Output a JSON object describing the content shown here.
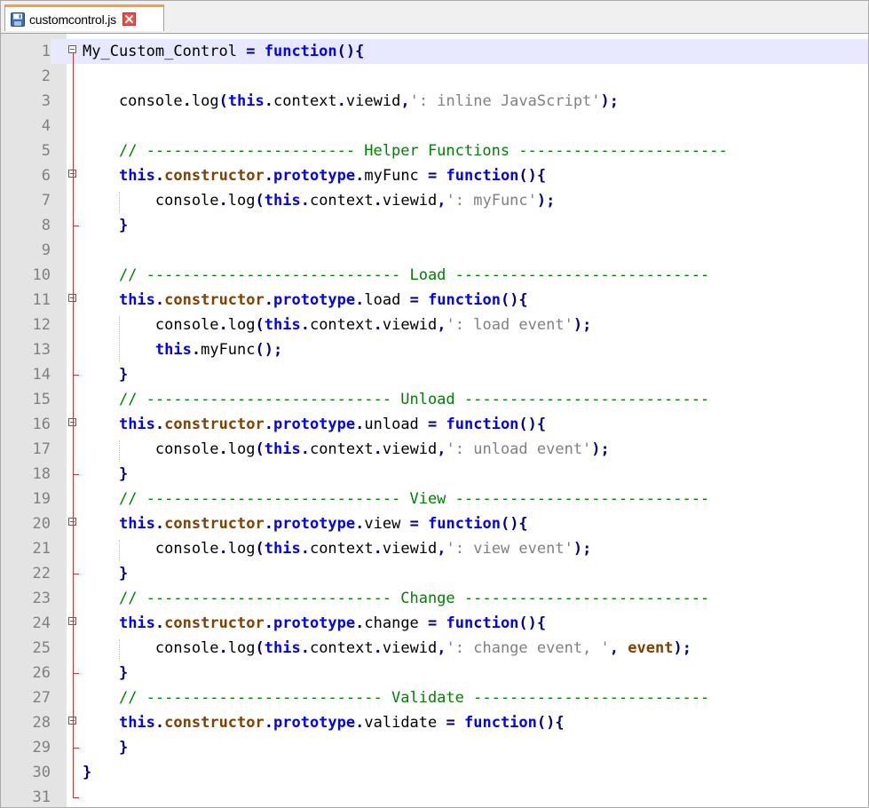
{
  "tab": {
    "label": "customcontrol.js",
    "save_icon": "save-icon",
    "close_icon": "close-icon"
  },
  "colors": {
    "keyword": "#0000ff",
    "this": "#0000ff",
    "member": "#804000",
    "string": "#808080",
    "comment": "#008000",
    "operator": "#000080",
    "current_line": "#e8e8ff",
    "tab_accent": "#f3a13a"
  },
  "lines": [
    {
      "n": "1",
      "fold": "start",
      "current": true,
      "tokens": [
        [
          "pl",
          "My_Custom_Control "
        ],
        [
          "op",
          "="
        ],
        [
          "pl",
          " "
        ],
        [
          "kw",
          "function"
        ],
        [
          "op",
          "(){"
        ]
      ]
    },
    {
      "n": "2",
      "tokens": []
    },
    {
      "n": "3",
      "tokens": [
        [
          "pl",
          "    console"
        ],
        [
          "op",
          "."
        ],
        [
          "pl",
          "log"
        ],
        [
          "op",
          "("
        ],
        [
          "kw",
          "this"
        ],
        [
          "op",
          "."
        ],
        [
          "pl",
          "context"
        ],
        [
          "op",
          "."
        ],
        [
          "pl",
          "viewid"
        ],
        [
          "op",
          ","
        ],
        [
          "str",
          "': inline JavaScript'"
        ],
        [
          "op",
          ");"
        ]
      ]
    },
    {
      "n": "4",
      "tokens": []
    },
    {
      "n": "5",
      "tokens": [
        [
          "pl",
          "    "
        ],
        [
          "cm",
          "// ----------------------- Helper Functions -----------------------"
        ]
      ]
    },
    {
      "n": "6",
      "fold": "start",
      "tokens": [
        [
          "pl",
          "    "
        ],
        [
          "kw",
          "this"
        ],
        [
          "op",
          "."
        ],
        [
          "br",
          "constructor"
        ],
        [
          "op",
          "."
        ],
        [
          "kw",
          "prototype"
        ],
        [
          "op",
          "."
        ],
        [
          "pl",
          "myFunc "
        ],
        [
          "op",
          "="
        ],
        [
          "pl",
          " "
        ],
        [
          "kw",
          "function"
        ],
        [
          "op",
          "(){"
        ]
      ]
    },
    {
      "n": "7",
      "tokens": [
        [
          "pl",
          "        console"
        ],
        [
          "op",
          "."
        ],
        [
          "pl",
          "log"
        ],
        [
          "op",
          "("
        ],
        [
          "kw",
          "this"
        ],
        [
          "op",
          "."
        ],
        [
          "pl",
          "context"
        ],
        [
          "op",
          "."
        ],
        [
          "pl",
          "viewid"
        ],
        [
          "op",
          ","
        ],
        [
          "str",
          "': myFunc'"
        ],
        [
          "op",
          ");"
        ]
      ]
    },
    {
      "n": "8",
      "fold": "end",
      "tokens": [
        [
          "pl",
          "    "
        ],
        [
          "op",
          "}"
        ]
      ]
    },
    {
      "n": "9",
      "tokens": []
    },
    {
      "n": "10",
      "tokens": [
        [
          "pl",
          "    "
        ],
        [
          "cm",
          "// ---------------------------- Load ----------------------------"
        ]
      ]
    },
    {
      "n": "11",
      "fold": "start",
      "tokens": [
        [
          "pl",
          "    "
        ],
        [
          "kw",
          "this"
        ],
        [
          "op",
          "."
        ],
        [
          "br",
          "constructor"
        ],
        [
          "op",
          "."
        ],
        [
          "kw",
          "prototype"
        ],
        [
          "op",
          "."
        ],
        [
          "pl",
          "load "
        ],
        [
          "op",
          "="
        ],
        [
          "pl",
          " "
        ],
        [
          "kw",
          "function"
        ],
        [
          "op",
          "(){"
        ]
      ]
    },
    {
      "n": "12",
      "tokens": [
        [
          "pl",
          "        console"
        ],
        [
          "op",
          "."
        ],
        [
          "pl",
          "log"
        ],
        [
          "op",
          "("
        ],
        [
          "kw",
          "this"
        ],
        [
          "op",
          "."
        ],
        [
          "pl",
          "context"
        ],
        [
          "op",
          "."
        ],
        [
          "pl",
          "viewid"
        ],
        [
          "op",
          ","
        ],
        [
          "str",
          "': load event'"
        ],
        [
          "op",
          ");"
        ]
      ]
    },
    {
      "n": "13",
      "tokens": [
        [
          "pl",
          "        "
        ],
        [
          "kw",
          "this"
        ],
        [
          "op",
          "."
        ],
        [
          "pl",
          "myFunc"
        ],
        [
          "op",
          "();"
        ]
      ]
    },
    {
      "n": "14",
      "fold": "end",
      "tokens": [
        [
          "pl",
          "    "
        ],
        [
          "op",
          "}"
        ]
      ]
    },
    {
      "n": "15",
      "tokens": [
        [
          "pl",
          "    "
        ],
        [
          "cm",
          "// --------------------------- Unload ---------------------------"
        ]
      ]
    },
    {
      "n": "16",
      "fold": "start",
      "tokens": [
        [
          "pl",
          "    "
        ],
        [
          "kw",
          "this"
        ],
        [
          "op",
          "."
        ],
        [
          "br",
          "constructor"
        ],
        [
          "op",
          "."
        ],
        [
          "kw",
          "prototype"
        ],
        [
          "op",
          "."
        ],
        [
          "pl",
          "unload "
        ],
        [
          "op",
          "="
        ],
        [
          "pl",
          " "
        ],
        [
          "kw",
          "function"
        ],
        [
          "op",
          "(){"
        ]
      ]
    },
    {
      "n": "17",
      "tokens": [
        [
          "pl",
          "        console"
        ],
        [
          "op",
          "."
        ],
        [
          "pl",
          "log"
        ],
        [
          "op",
          "("
        ],
        [
          "kw",
          "this"
        ],
        [
          "op",
          "."
        ],
        [
          "pl",
          "context"
        ],
        [
          "op",
          "."
        ],
        [
          "pl",
          "viewid"
        ],
        [
          "op",
          ","
        ],
        [
          "str",
          "': unload event'"
        ],
        [
          "op",
          ");"
        ]
      ]
    },
    {
      "n": "18",
      "fold": "end",
      "tokens": [
        [
          "pl",
          "    "
        ],
        [
          "op",
          "}"
        ]
      ]
    },
    {
      "n": "19",
      "tokens": [
        [
          "pl",
          "    "
        ],
        [
          "cm",
          "// ---------------------------- View ----------------------------"
        ]
      ]
    },
    {
      "n": "20",
      "fold": "start",
      "tokens": [
        [
          "pl",
          "    "
        ],
        [
          "kw",
          "this"
        ],
        [
          "op",
          "."
        ],
        [
          "br",
          "constructor"
        ],
        [
          "op",
          "."
        ],
        [
          "kw",
          "prototype"
        ],
        [
          "op",
          "."
        ],
        [
          "pl",
          "view "
        ],
        [
          "op",
          "="
        ],
        [
          "pl",
          " "
        ],
        [
          "kw",
          "function"
        ],
        [
          "op",
          "(){"
        ]
      ]
    },
    {
      "n": "21",
      "tokens": [
        [
          "pl",
          "        console"
        ],
        [
          "op",
          "."
        ],
        [
          "pl",
          "log"
        ],
        [
          "op",
          "("
        ],
        [
          "kw",
          "this"
        ],
        [
          "op",
          "."
        ],
        [
          "pl",
          "context"
        ],
        [
          "op",
          "."
        ],
        [
          "pl",
          "viewid"
        ],
        [
          "op",
          ","
        ],
        [
          "str",
          "': view event'"
        ],
        [
          "op",
          ");"
        ]
      ]
    },
    {
      "n": "22",
      "fold": "end",
      "tokens": [
        [
          "pl",
          "    "
        ],
        [
          "op",
          "}"
        ]
      ]
    },
    {
      "n": "23",
      "tokens": [
        [
          "pl",
          "    "
        ],
        [
          "cm",
          "// --------------------------- Change ---------------------------"
        ]
      ]
    },
    {
      "n": "24",
      "fold": "start",
      "tokens": [
        [
          "pl",
          "    "
        ],
        [
          "kw",
          "this"
        ],
        [
          "op",
          "."
        ],
        [
          "br",
          "constructor"
        ],
        [
          "op",
          "."
        ],
        [
          "kw",
          "prototype"
        ],
        [
          "op",
          "."
        ],
        [
          "pl",
          "change "
        ],
        [
          "op",
          "="
        ],
        [
          "pl",
          " "
        ],
        [
          "kw",
          "function"
        ],
        [
          "op",
          "(){"
        ]
      ]
    },
    {
      "n": "25",
      "tokens": [
        [
          "pl",
          "        console"
        ],
        [
          "op",
          "."
        ],
        [
          "pl",
          "log"
        ],
        [
          "op",
          "("
        ],
        [
          "kw",
          "this"
        ],
        [
          "op",
          "."
        ],
        [
          "pl",
          "context"
        ],
        [
          "op",
          "."
        ],
        [
          "pl",
          "viewid"
        ],
        [
          "op",
          ","
        ],
        [
          "str",
          "': change event, '"
        ],
        [
          "op",
          ","
        ],
        [
          "pl",
          " "
        ],
        [
          "br",
          "event"
        ],
        [
          "op",
          ");"
        ]
      ]
    },
    {
      "n": "26",
      "fold": "end",
      "tokens": [
        [
          "pl",
          "    "
        ],
        [
          "op",
          "}"
        ]
      ]
    },
    {
      "n": "27",
      "tokens": [
        [
          "pl",
          "    "
        ],
        [
          "cm",
          "// -------------------------- Validate --------------------------"
        ]
      ]
    },
    {
      "n": "28",
      "fold": "start",
      "tokens": [
        [
          "pl",
          "    "
        ],
        [
          "kw",
          "this"
        ],
        [
          "op",
          "."
        ],
        [
          "br",
          "constructor"
        ],
        [
          "op",
          "."
        ],
        [
          "kw",
          "prototype"
        ],
        [
          "op",
          "."
        ],
        [
          "pl",
          "validate "
        ],
        [
          "op",
          "="
        ],
        [
          "pl",
          " "
        ],
        [
          "kw",
          "function"
        ],
        [
          "op",
          "(){"
        ]
      ]
    },
    {
      "n": "29",
      "fold": "end",
      "tokens": [
        [
          "pl",
          "    "
        ],
        [
          "op",
          "}"
        ]
      ]
    },
    {
      "n": "30",
      "tokens": [
        [
          "op",
          "}"
        ]
      ]
    },
    {
      "n": "31",
      "fold": "last",
      "tokens": []
    }
  ]
}
